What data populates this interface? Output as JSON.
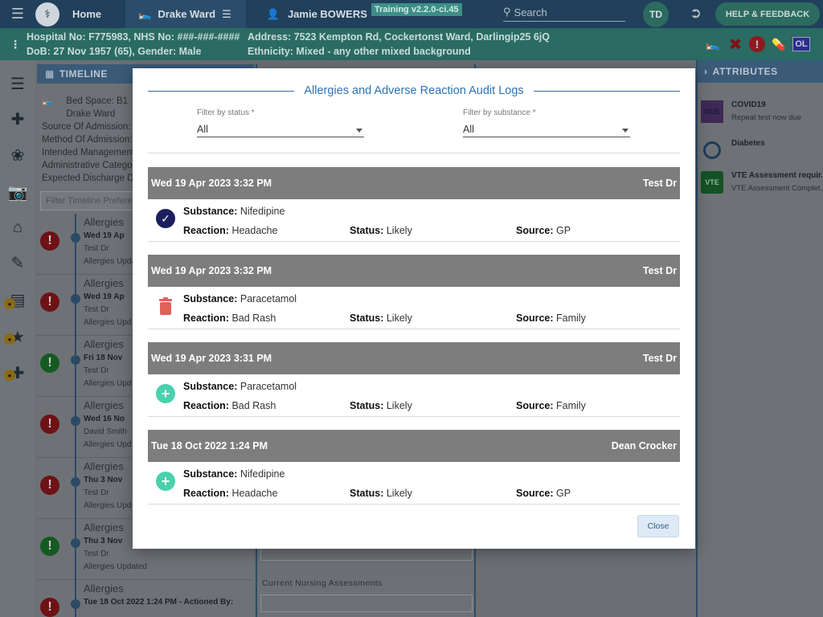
{
  "topbar": {
    "home_label": "Home",
    "ward_label": "Drake Ward",
    "patient_name": "Jamie BOWERS",
    "version_badge": "Training v2.2.0-ci.45",
    "search_placeholder": "Search",
    "user_initials": "TD",
    "help_label": "HELP & FEEDBACK"
  },
  "banner": {
    "ids": "Hospital No: F775983, NHS No: ###-###-####",
    "dob": "DoB: 27 Nov 1957 (65), Gender: Male",
    "address": "Address: 7523 Kempton Rd, Cockertonst Ward, Darlingip25 6jQ",
    "ethnicity": "Ethnicity: Mixed - any other mixed background",
    "flag_ol": "OL"
  },
  "timeline": {
    "header": "TIMELINE",
    "bed_space": "Bed Space: B1",
    "ward": "Drake Ward",
    "lines": [
      "Source Of Admission: I",
      "Method Of Admission:",
      "Intended Management",
      "Administrative Catego",
      "Expected Discharge Da"
    ],
    "filter_placeholder": "Filter Timeline Prefere",
    "entries": [
      {
        "title": "Allergies",
        "date": "Wed 19 Ap",
        "by": "Test Dr",
        "updated": "Allergies Upda"
      },
      {
        "title": "Allergies",
        "date": "Wed 19 Ap",
        "by": "Test Dr",
        "updated": "Allergies Upd"
      },
      {
        "title": "Allergies",
        "date": "Fri 18 Nov",
        "by": "Test Dr",
        "updated": "Allergies Upd"
      },
      {
        "title": "Allergies",
        "date": "Wed 16 No",
        "by": "David Smith",
        "updated": "Allergies Upd"
      },
      {
        "title": "Allergies",
        "date": "Thu 3 Nov",
        "by": "Test Dr",
        "updated": "Allergies Upd"
      },
      {
        "title": "Allergies",
        "date": "Thu 3 Nov",
        "by": "Test Dr",
        "updated": "Allergies Updated"
      },
      {
        "title": "Allergies",
        "date": "Tue 18 Oct 2022 1:24 PM - Actioned By:",
        "by": "",
        "updated": ""
      }
    ]
  },
  "middle": {
    "nursing_label": "Current Nursing Assessments"
  },
  "attributes": {
    "header": "ATTRIBUTES",
    "items": [
      {
        "badge": "DUE",
        "title": "COVID19",
        "sub": "Repeat test now due"
      },
      {
        "badge": "",
        "title": "Diabetes",
        "sub": ""
      },
      {
        "badge": "VTE",
        "title": "VTE Assessment requir...",
        "sub": "VTE Assessment Complet..."
      }
    ]
  },
  "modal": {
    "title": "Allergies and Adverse Reaction Audit Logs",
    "filter_status": {
      "label": "Filter by status *",
      "value": "All"
    },
    "filter_substance": {
      "label": "Filter by substance *",
      "value": "All"
    },
    "field_labels": {
      "substance": "Substance:",
      "reaction": "Reaction:",
      "status": "Status:",
      "source": "Source:"
    },
    "logs": [
      {
        "datetime": "Wed 19 Apr 2023 3:32 PM",
        "author": "Test Dr",
        "action": "verified",
        "substance": "Nifedipine",
        "reaction": "Headache",
        "status": "Likely",
        "source": "GP"
      },
      {
        "datetime": "Wed 19 Apr 2023 3:32 PM",
        "author": "Test Dr",
        "action": "deleted",
        "substance": "Paracetamol",
        "reaction": "Bad Rash",
        "status": "Likely",
        "source": "Family"
      },
      {
        "datetime": "Wed 19 Apr 2023 3:31 PM",
        "author": "Test Dr",
        "action": "added",
        "substance": "Paracetamol",
        "reaction": "Bad Rash",
        "status": "Likely",
        "source": "Family"
      },
      {
        "datetime": "Tue 18 Oct 2022 1:24 PM",
        "author": "Dean Crocker",
        "action": "added",
        "substance": "Nifedipine",
        "reaction": "Headache",
        "status": "Likely",
        "source": "GP"
      }
    ],
    "close_label": "Close"
  },
  "colors": {
    "topbar": "#20405b",
    "banner": "#2a6b63",
    "modal_title": "#2f74b5",
    "log_header": "#7d7d7d",
    "verified_icon": "#1b1f5e",
    "delete_icon": "#e0605b",
    "add_icon": "#4ad0ad"
  }
}
